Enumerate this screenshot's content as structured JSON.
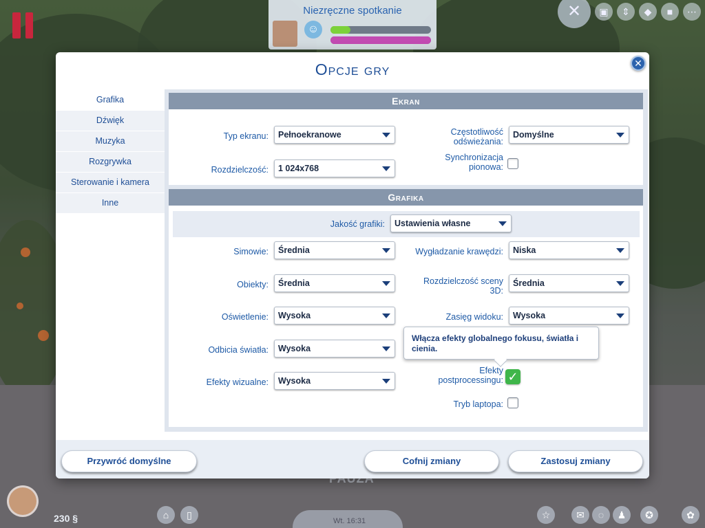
{
  "hud": {
    "mood_title": "Niezręczne spotkanie",
    "mood_icon": "embarrassed-emoji-icon",
    "pause_label": "PAUZA",
    "funds": "230 §",
    "clock": "Wt. 16:31",
    "mood_bar_fractions": [
      0.2,
      1.0
    ],
    "colors": {
      "pause": "#c8263d",
      "mood_green": "#7cd13a",
      "mood_pink": "#c24bb2"
    }
  },
  "dialog": {
    "title": "Opcje gry",
    "close_icon": "close-icon",
    "sidebar": [
      {
        "label": "Grafika",
        "active": true
      },
      {
        "label": "Dźwięk"
      },
      {
        "label": "Muzyka"
      },
      {
        "label": "Rozgrywka"
      },
      {
        "label": "Sterowanie i kamera"
      },
      {
        "label": "Inne"
      }
    ],
    "ekran": {
      "heading": "Ekran",
      "screen_type": {
        "label": "Typ ekranu:",
        "value": "Pełnoekranowe"
      },
      "resolution": {
        "label": "Rozdzielczość:",
        "value": "1 024x768"
      },
      "refresh": {
        "label_line1": "Częstotliwość",
        "label_line2": "odświeżania:",
        "value": "Domyślne"
      },
      "vsync": {
        "label_line1": "Synchronizacja",
        "label_line2": "pionowa:",
        "checked": false
      }
    },
    "grafika": {
      "heading": "Grafika",
      "quality": {
        "label": "Jakość grafiki:",
        "value": "Ustawienia własne"
      },
      "sims": {
        "label": "Simowie:",
        "value": "Średnia"
      },
      "objects": {
        "label": "Obiekty:",
        "value": "Średnia"
      },
      "lighting": {
        "label": "Oświetlenie:",
        "value": "Wysoka"
      },
      "reflections": {
        "label": "Odbicia światła:",
        "value": "Wysoka"
      },
      "visual_effects": {
        "label": "Efekty wizualne:",
        "value": "Wysoka"
      },
      "edge_smoothing": {
        "label": "Wygładzanie krawędzi:",
        "value": "Niska"
      },
      "scene_resolution": {
        "label_line1": "Rozdzielczość sceny",
        "label_line2": "3D:",
        "value": "Średnia"
      },
      "view_distance": {
        "label": "Zasięg widoku:",
        "value": "Wysoka"
      },
      "postprocessing": {
        "label_line1": "Efekty",
        "label_line2": "postprocessingu:",
        "checked": true
      },
      "laptop_mode": {
        "label": "Tryb laptopa:",
        "checked": false
      },
      "tooltip": "Włącza efekty globalnego fokusu, światła i cienia."
    },
    "buttons": {
      "restore_defaults": "Przywróć domyślne",
      "undo": "Cofnij zmiany",
      "apply": "Zastosuj zmiany"
    }
  }
}
